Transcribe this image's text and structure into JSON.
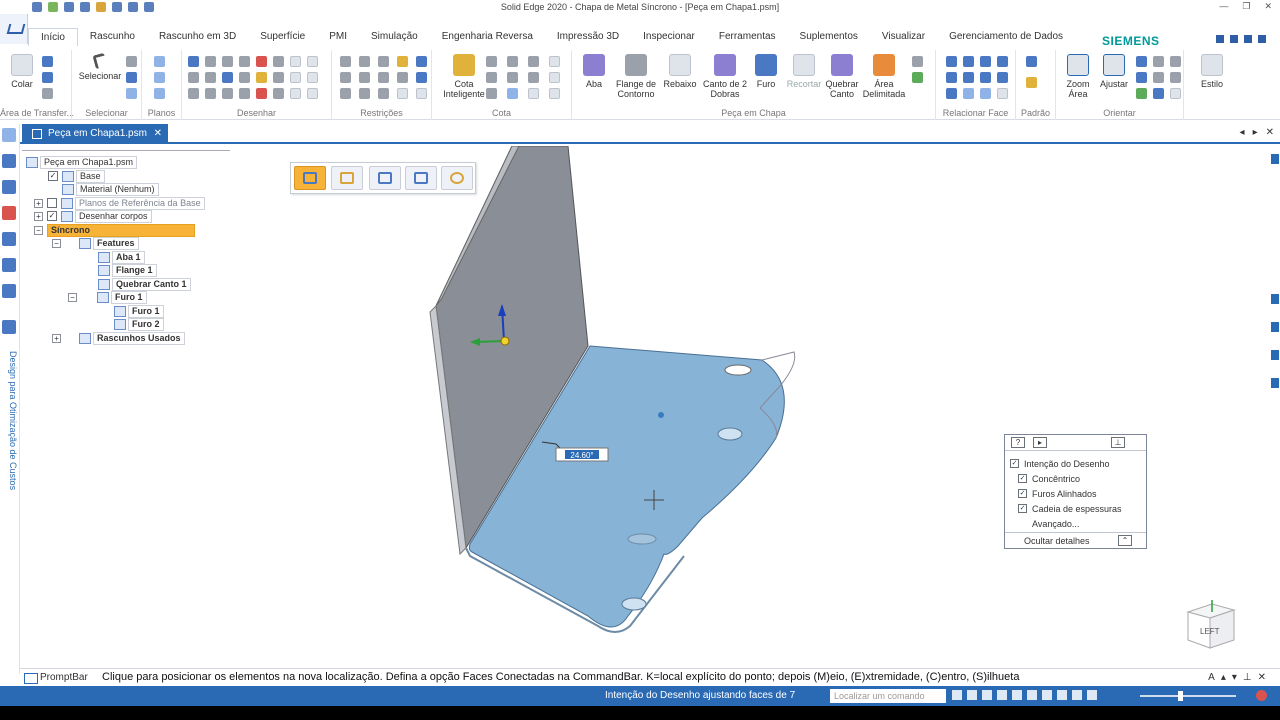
{
  "window": {
    "title": "Solid Edge 2020 - Chapa de Metal Síncrono - [Peça em Chapa1.psm]"
  },
  "ribbon_tabs": [
    "Início",
    "Rascunho",
    "Rascunho em 3D",
    "Superfície",
    "PMI",
    "Simulação",
    "Engenharia Reversa",
    "Impressão 3D",
    "Inspecionar",
    "Ferramentas",
    "Suplementos",
    "Visualizar",
    "Gerenciamento de Dados"
  ],
  "brand": "SIEMENS",
  "ribbon": {
    "colar": "Colar",
    "area_transferencia": "Área de Transfer...",
    "selecionar_btn": "Selecionar",
    "selecionar_group": "Selecionar",
    "planos": "Planos",
    "desenhar": "Desenhar",
    "restricoes": "Restrições",
    "cota_inteligente": "Cota Inteligente",
    "cota": "Cota",
    "aba": "Aba",
    "flange_contorno": "Flange de Contorno",
    "rebaixo": "Rebaixo",
    "canto_2_dobras": "Canto de 2 Dobras",
    "furo": "Furo",
    "recortar": "Recortar",
    "quebrar_canto": "Quebrar Canto",
    "area_delimitada": "Área Delimitada",
    "peca_em_chapa": "Peça em Chapa",
    "relacionar_face": "Relacionar Face",
    "padrao": "Padrão",
    "zoom_area": "Zoom Área",
    "ajustar": "Ajustar",
    "orientar": "Orientar",
    "estilo": "Estilo"
  },
  "doc_tab": {
    "name": "Peça em Chapa1.psm",
    "close": "✕"
  },
  "side_panel": {
    "vertical_label": "Design para Otimização de Custos"
  },
  "tree": [
    {
      "label": "Peça em Chapa1.psm"
    },
    {
      "label": "Base"
    },
    {
      "label": "Material (Nenhum)"
    },
    {
      "label": "Planos de Referência da Base"
    },
    {
      "label": "Desenhar corpos"
    },
    {
      "label": "Síncrono"
    },
    {
      "label": "Features"
    },
    {
      "label": "Aba 1"
    },
    {
      "label": "Flange 1"
    },
    {
      "label": "Quebrar Canto 1"
    },
    {
      "label": "Furo 1"
    },
    {
      "label": "Furo 1"
    },
    {
      "label": "Furo 2"
    },
    {
      "label": "Rascunhos Usados"
    }
  ],
  "dimension": {
    "angle": "24.60°"
  },
  "view_cube": {
    "label": "LEFT"
  },
  "design_intent": {
    "title": "Intenção do Desenho",
    "options": [
      {
        "label": "Concêntrico",
        "checked": true
      },
      {
        "label": "Furos Alinhados",
        "checked": true
      },
      {
        "label": "Cadeia de espessuras",
        "checked": true
      }
    ],
    "advanced": "Avançado...",
    "hide_details": "Ocultar detalhes"
  },
  "prompt": {
    "label": "PromptBar",
    "text": "Clique para posicionar os elementos na nova localização. Defina a opção Faces Conectadas na CommandBar. K=local explícito do ponto; depois (M)eio, (E)xtremidade, (C)entro, (S)ilhueta"
  },
  "status": {
    "text": "Intenção do Desenho ajustando faces de 7",
    "search_placeholder": "Localizar um comando"
  },
  "colors": {
    "accent": "#2a6ab4",
    "brand": "#009999",
    "selection": "#f6b338",
    "face_blue": "#87b3d6",
    "face_gray": "#8a8e97"
  }
}
